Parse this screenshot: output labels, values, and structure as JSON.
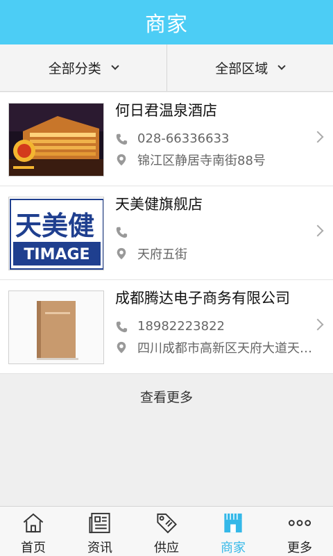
{
  "header": {
    "title": "商家"
  },
  "filters": {
    "category": "全部分类",
    "region": "全部区域"
  },
  "merchants": [
    {
      "name": "何日君温泉酒店",
      "phone": "028-66336633",
      "address": "锦江区静居寺南街88号",
      "thumb": "hotel-photo"
    },
    {
      "name": "天美健旗舰店",
      "phone": "",
      "address": "天府五街",
      "thumb": "timage-logo",
      "logo_text_cn": "天美健",
      "logo_text_en": "TIMAGE"
    },
    {
      "name": "成都腾达电子商务有限公司",
      "phone": "18982223822",
      "address": "四川成都市高新区天府大道天…",
      "thumb": "box-photo"
    }
  ],
  "more_label": "查看更多",
  "tabs": [
    {
      "label": "首页",
      "icon": "home-icon"
    },
    {
      "label": "资讯",
      "icon": "news-icon"
    },
    {
      "label": "供应",
      "icon": "tag-icon"
    },
    {
      "label": "商家",
      "icon": "store-icon",
      "active": true
    },
    {
      "label": "更多",
      "icon": "more-icon"
    }
  ],
  "colors": {
    "accent": "#4ccdf5",
    "active_tab": "#34b8e8"
  }
}
